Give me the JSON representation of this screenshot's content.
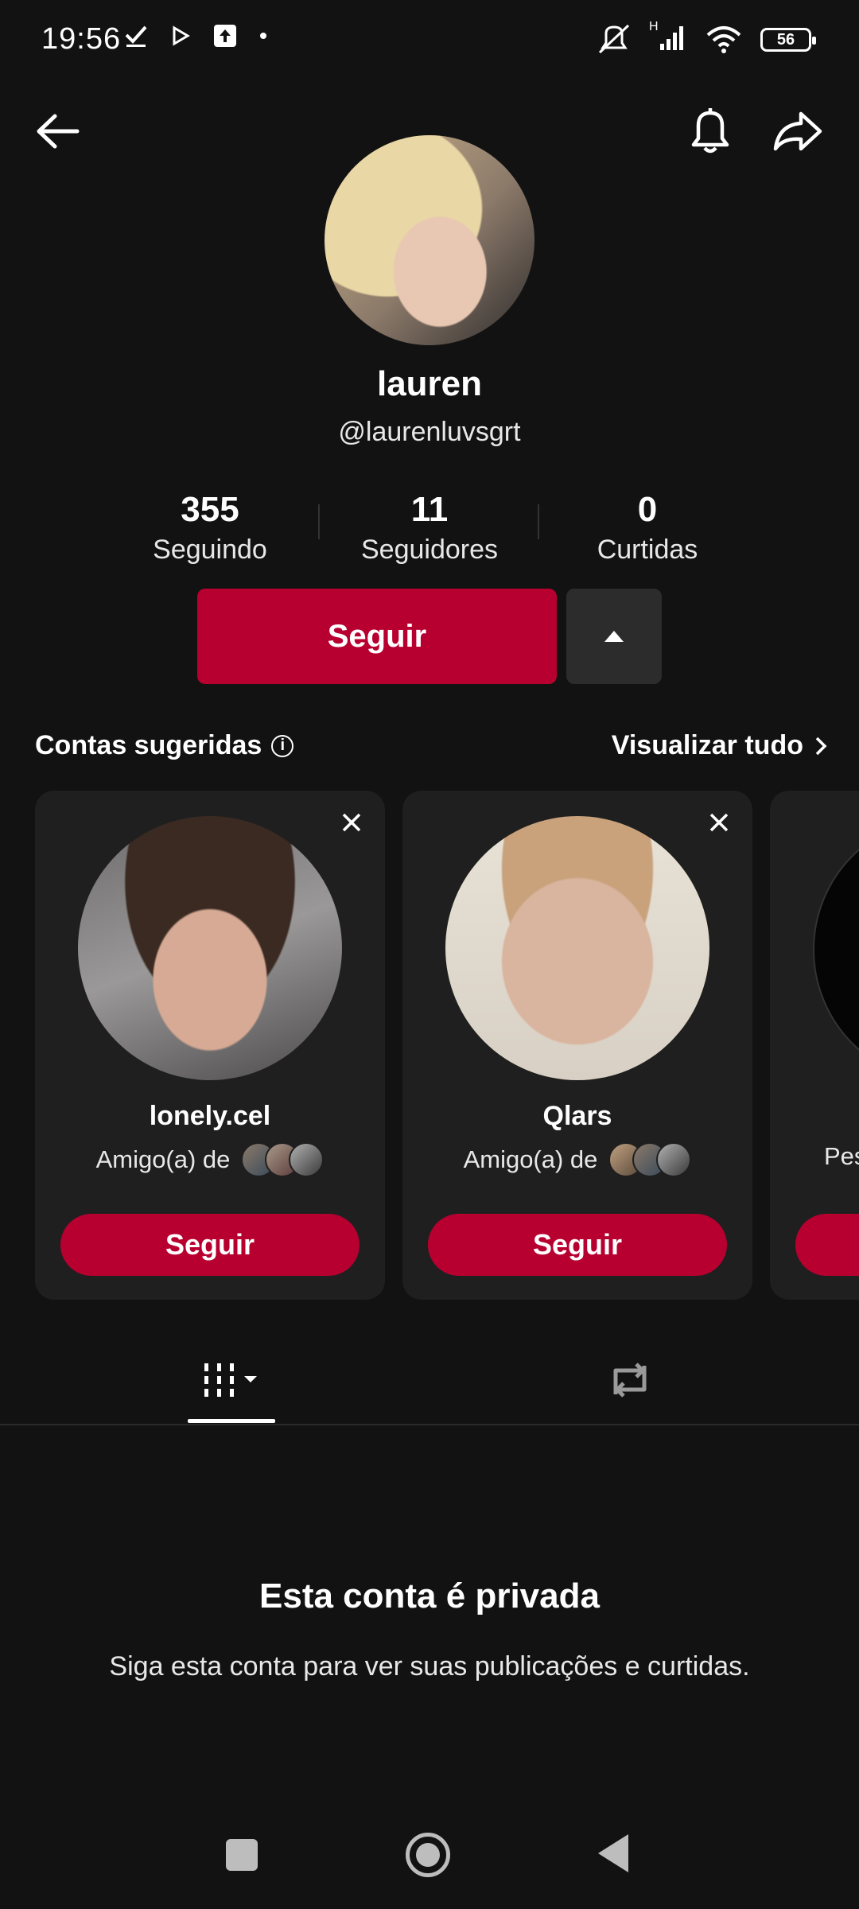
{
  "status_bar": {
    "time": "19:56",
    "battery": "56",
    "signal_label": "H"
  },
  "header": {
    "back_icon": "arrow-left-icon",
    "bell_icon": "bell-icon",
    "share_icon": "share-icon"
  },
  "profile": {
    "name": "lauren",
    "handle": "@laurenluvsgrt",
    "stats": [
      {
        "value": "355",
        "label": "Seguindo"
      },
      {
        "value": "11",
        "label": "Seguidores"
      },
      {
        "value": "0",
        "label": "Curtidas"
      }
    ],
    "follow_label": "Seguir"
  },
  "suggested": {
    "title": "Contas sugeridas",
    "view_all": "Visualizar tudo",
    "cards": [
      {
        "name": "lonely.cel",
        "sub": "Amigo(a) de",
        "button": "Seguir"
      },
      {
        "name": "Qlars",
        "sub": "Amigo(a) de",
        "button": "Seguir"
      },
      {
        "name": "",
        "sub": "Pes",
        "button": ""
      }
    ]
  },
  "tabs": {
    "grid_icon": "grid-icon",
    "repost_icon": "repost-icon"
  },
  "private": {
    "title": "Esta conta é privada",
    "text": "Siga esta conta para ver suas publicações e curtidas."
  },
  "colors": {
    "accent": "#b70030",
    "background": "#121212",
    "card": "#1f1f1f"
  }
}
